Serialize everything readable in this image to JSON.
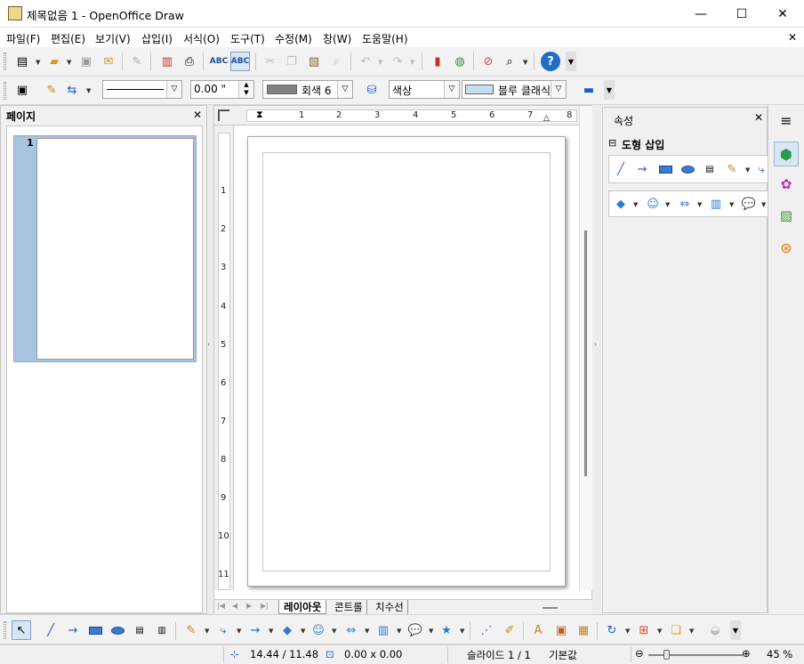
{
  "window": {
    "title": "제목없음 1 - OpenOffice Draw",
    "minimize": "—",
    "maximize": "☐",
    "close": "✕",
    "doc_close": "✕"
  },
  "menu": [
    "파일(F)",
    "편집(E)",
    "보기(V)",
    "삽입(I)",
    "서식(O)",
    "도구(T)",
    "수정(M)",
    "창(W)",
    "도움말(H)"
  ],
  "line_toolbar": {
    "line_width": "0.00 \"",
    "line_color": "회색 6",
    "area_style": "색상",
    "area_color": "블루 클래식"
  },
  "pages_panel": {
    "title": "페이지",
    "close": "✕",
    "pages": [
      {
        "number": "1"
      }
    ]
  },
  "properties_panel": {
    "title": "속성",
    "close": "✕",
    "section_toggle": "⊟",
    "section_title": "도형 삽입"
  },
  "tabs": [
    "레이아웃",
    "콘트롤",
    "치수선"
  ],
  "ruler": {
    "h_ticks": [
      "1",
      "2",
      "3",
      "4",
      "5",
      "6",
      "7",
      "8"
    ],
    "v_ticks": [
      "1",
      "2",
      "3",
      "4",
      "5",
      "6",
      "7",
      "8",
      "9",
      "10",
      "11"
    ]
  },
  "status": {
    "position": "14.44 / 11.48",
    "size": "0.00 x 0.00",
    "slide": "슬라이드 1 / 1",
    "layout": "기본값",
    "zoom": "45 %",
    "zoom_minus": "⊖",
    "zoom_plus": "⊕",
    "zoom_level": 0.45
  },
  "colors": {
    "accent": "#a9c4e0",
    "line_color_swatch": "#808080",
    "area_color_swatch": "#c6dff0",
    "help_blue": "#1e6ec8"
  }
}
